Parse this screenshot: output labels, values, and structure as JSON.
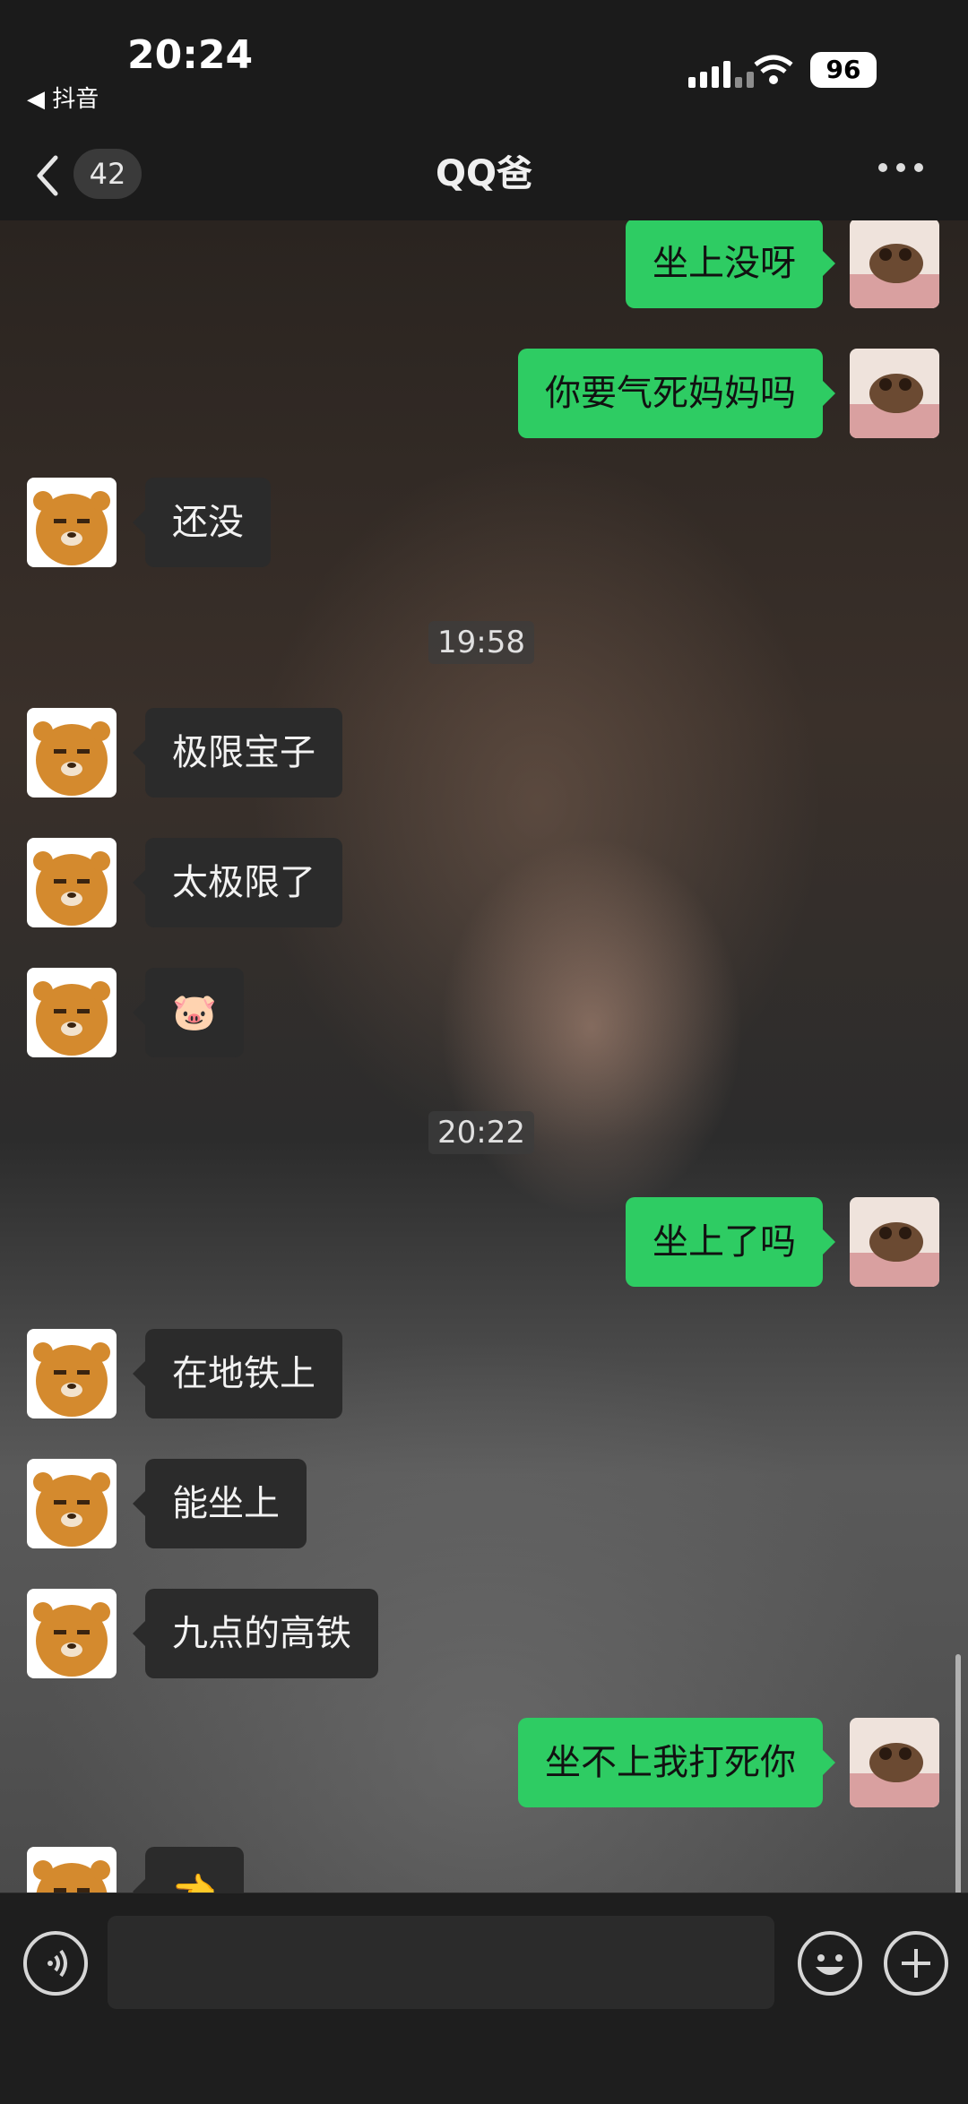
{
  "status_bar": {
    "time": "20:24",
    "back_app_label": "◀ 抖音",
    "battery": "96"
  },
  "nav": {
    "title": "QQ爸",
    "unread_badge": "42"
  },
  "messages": [
    {
      "side": "right",
      "text": "坐上没呀"
    },
    {
      "side": "right",
      "text": "你要气死妈妈吗"
    },
    {
      "side": "left",
      "text": "还没"
    },
    {
      "side": "left",
      "text": "极限宝子"
    },
    {
      "side": "left",
      "text": "太极限了"
    },
    {
      "side": "left",
      "text": "🐷"
    },
    {
      "side": "right",
      "text": "坐上了吗"
    },
    {
      "side": "left",
      "text": "在地铁上"
    },
    {
      "side": "left",
      "text": "能坐上"
    },
    {
      "side": "left",
      "text": "九点的高铁"
    },
    {
      "side": "right",
      "text": "坐不上我打死你"
    },
    {
      "side": "left",
      "text": "👈"
    }
  ],
  "timestamps": [
    "19:58",
    "20:22"
  ],
  "colors": {
    "accent_green": "#2ecc63",
    "bubble_dark": "#2b2b2b",
    "background": "#1b1b1b"
  },
  "icons": {
    "voice": "voice-icon",
    "emoji": "emoji-icon",
    "add": "plus-icon",
    "back": "chevron-left-icon",
    "more": "more-dots-icon"
  }
}
